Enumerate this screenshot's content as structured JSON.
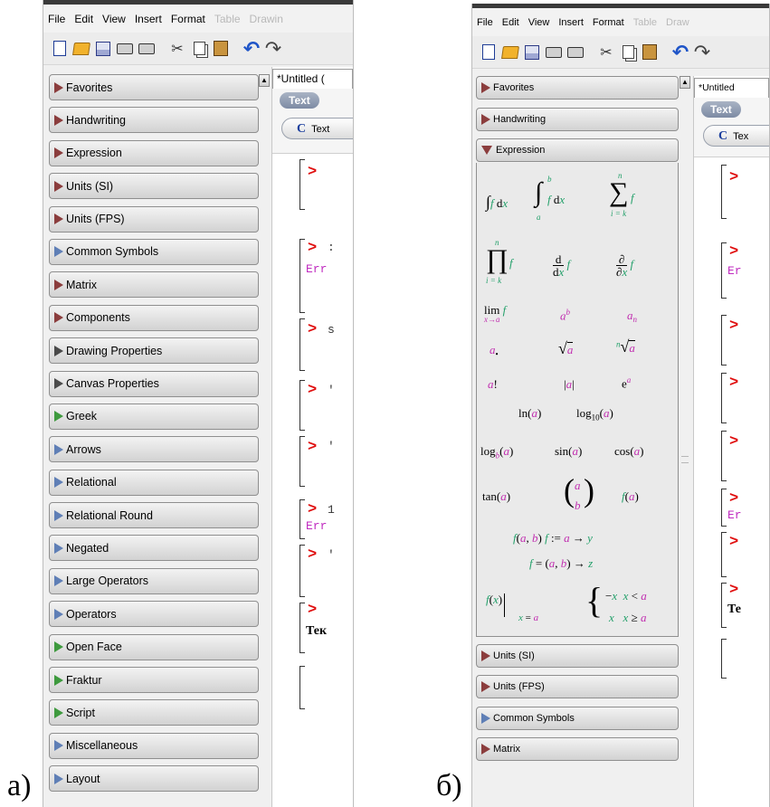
{
  "labels": {
    "a": "а)",
    "b": "б)"
  },
  "menu": {
    "file": "File",
    "edit": "Edit",
    "view": "View",
    "insert": "Insert",
    "format": "Format",
    "table": "Table",
    "drawing_a": "Drawin",
    "drawing_b": "Draw"
  },
  "toolbar_icons": [
    "new-document-icon",
    "open-folder-icon",
    "save-icon",
    "print-icon",
    "print-preview-icon",
    "cut-icon",
    "copy-icon",
    "paste-icon",
    "undo-icon",
    "redo-icon"
  ],
  "document": {
    "tab_a": "*Untitled (",
    "tab_b": "*Untitled",
    "context_text": "Text",
    "context_button_a": "Text",
    "context_button_b": "Tex"
  },
  "worksheet": {
    "prompt": ">",
    "error_a": "Err",
    "error_b": "Er",
    "text_a": "Тек",
    "text_b": "Те",
    "trunc_1": ":",
    "trunc_2": "s",
    "trunc_3": "'",
    "trunc_4": "'",
    "trunc_5": "1",
    "trunc_6": "'"
  },
  "palettes_a": [
    {
      "label": "Favorites",
      "color": "red"
    },
    {
      "label": "Handwriting",
      "color": "red"
    },
    {
      "label": "Expression",
      "color": "red"
    },
    {
      "label": "Units (SI)",
      "color": "red"
    },
    {
      "label": "Units (FPS)",
      "color": "red"
    },
    {
      "label": "Common Symbols",
      "color": "blue"
    },
    {
      "label": "Matrix",
      "color": "red"
    },
    {
      "label": "Components",
      "color": "red"
    },
    {
      "label": "Drawing Properties",
      "color": "dark"
    },
    {
      "label": "Canvas Properties",
      "color": "dark"
    },
    {
      "label": "Greek",
      "color": "green"
    },
    {
      "label": "Arrows",
      "color": "blue"
    },
    {
      "label": "Relational",
      "color": "blue"
    },
    {
      "label": "Relational Round",
      "color": "blue"
    },
    {
      "label": "Negated",
      "color": "blue"
    },
    {
      "label": "Large Operators",
      "color": "blue"
    },
    {
      "label": "Operators",
      "color": "blue"
    },
    {
      "label": "Open Face",
      "color": "green"
    },
    {
      "label": "Fraktur",
      "color": "green"
    },
    {
      "label": "Script",
      "color": "green"
    },
    {
      "label": "Miscellaneous",
      "color": "blue"
    },
    {
      "label": "Layout",
      "color": "blue"
    }
  ],
  "palettes_b_top": [
    {
      "label": "Favorites",
      "color": "red"
    },
    {
      "label": "Handwriting",
      "color": "red"
    }
  ],
  "expression_header": "Expression",
  "palettes_b_bottom": [
    {
      "label": "Units (SI)",
      "color": "red"
    },
    {
      "label": "Units (FPS)",
      "color": "red"
    },
    {
      "label": "Common Symbols",
      "color": "blue"
    },
    {
      "label": "Matrix",
      "color": "red"
    }
  ],
  "expression_symbols": {
    "r1c1": "∫f dx",
    "r1c2_upper": "b",
    "r1c2_lower": "a",
    "r1c2_body": "∫f dx",
    "r1c3_upper": "n",
    "r1c3_lower": "i = k",
    "r1c3_body": "∑f",
    "r2c1_upper": "n",
    "r2c1_lower": "i = k",
    "r2c1_body": "∏f",
    "r2c2": "d/dx f",
    "r2c3": "∂/∂x f",
    "r3c1": "lim f",
    "r3c1_sub": "x→a",
    "r3c2": "a",
    "r3c2_sup": "b",
    "r3c3": "a",
    "r3c3_sub": "n",
    "r4c1": "a",
    "r4c1_sub": "•",
    "r4c2": "√a",
    "r4c3_idx": "n",
    "r4c3": "√a",
    "r5c1": "a!",
    "r5c2": "|a|",
    "r5c3": "e",
    "r5c3_sup": "a",
    "r6c1": "ln(a)",
    "r6c2": "log",
    "r6c2_sub": "10",
    "r6c2_arg": "(a)",
    "r7c1": "log",
    "r7c1_sub": "b",
    "r7c1_arg": "(a)",
    "r7c2": "sin(a)",
    "r7c3": "cos(a)",
    "r8c1": "tan(a)",
    "r8c2_top": "a",
    "r8c2_bot": "b",
    "r8c3": "f(a)",
    "r9": "f(a, b)  f := a → y",
    "r10": "f = (a, b) → z",
    "r11_left": "f(x)",
    "r11_sub": "x = a",
    "r11_case1": "−x   x < a",
    "r11_case2": "x   x ≥ a"
  }
}
